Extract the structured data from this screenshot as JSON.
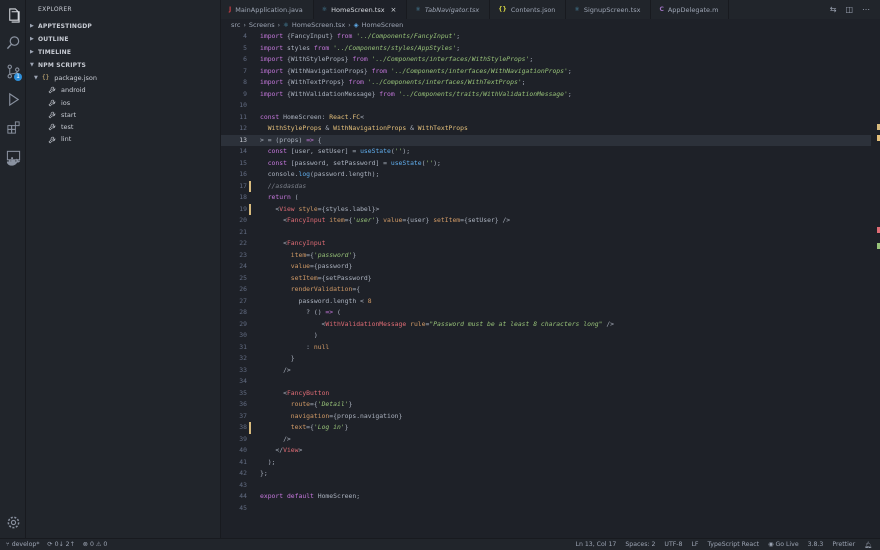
{
  "sidebar": {
    "title": "EXPLORER",
    "sections": [
      "APPTESTINGDP",
      "OUTLINE",
      "TIMELINE",
      "NPM SCRIPTS"
    ],
    "npm": {
      "package": "package.json",
      "scripts": [
        "android",
        "ios",
        "start",
        "test",
        "lint"
      ]
    }
  },
  "tabs": [
    {
      "label": "MainApplication.java",
      "icon": "J",
      "color": "#cc3e44",
      "active": false,
      "italic": false
    },
    {
      "label": "HomeScreen.tsx",
      "icon": "⚛",
      "color": "#519aba",
      "active": true,
      "italic": false
    },
    {
      "label": "TabNavigator.tsx",
      "icon": "⚛",
      "color": "#519aba",
      "active": false,
      "italic": true
    },
    {
      "label": "Contents.json",
      "icon": "{}",
      "color": "#cbcb41",
      "active": false,
      "italic": false
    },
    {
      "label": "SignupScreen.tsx",
      "icon": "⚛",
      "color": "#519aba",
      "active": false,
      "italic": false
    },
    {
      "label": "AppDelegate.m",
      "icon": "C",
      "color": "#a074c4",
      "active": false,
      "italic": false
    }
  ],
  "breadcrumb": [
    "src",
    "Screens",
    "HomeScreen.tsx",
    "HomeScreen"
  ],
  "status": {
    "branch": "develop*",
    "sync": "0↓ 2↑",
    "problems": "⊗ 0 ⚠ 0",
    "position": "Ln 13, Col 17",
    "spaces": "Spaces: 2",
    "encoding": "UTF-8",
    "eol": "LF",
    "language": "TypeScript React",
    "golive": "Go Live",
    "version": "3.8.3",
    "formatter": "Prettier"
  },
  "code_lines": [
    {
      "n": "4",
      "html": "<span class='k'>import</span> {FancyInput} <span class='k'>from</span> <span class='s'>'../Components/FancyInput'</span>;"
    },
    {
      "n": "5",
      "html": "<span class='k'>import</span> styles <span class='k'>from</span> <span class='s'>'../Components/styles/AppStyles'</span>;"
    },
    {
      "n": "6",
      "html": "<span class='k'>import</span> {WithStyleProps} <span class='k'>from</span> <span class='s'>'../Components/interfaces/WithStyleProps'</span>;"
    },
    {
      "n": "7",
      "html": "<span class='k'>import</span> {WithNavigationProps} <span class='k'>from</span> <span class='s'>'../Components/interfaces/WithNavigationProps'</span>;"
    },
    {
      "n": "8",
      "html": "<span class='k'>import</span> {WithTextProps} <span class='k'>from</span> <span class='s'>'../Components/interfaces/WithTextProps'</span>;"
    },
    {
      "n": "9",
      "html": "<span class='k'>import</span> {WithValidationMessage} <span class='k'>from</span> <span class='s'>'../Components/traits/WithValidationMessage'</span>;"
    },
    {
      "n": "10",
      "html": ""
    },
    {
      "n": "11",
      "html": "<span class='k'>const</span> <span class='p'>HomeScreen</span>: <span class='t'>React</span>.<span class='t'>FC</span>&lt;"
    },
    {
      "n": "12",
      "html": "  <span class='t'>WithStyleProps</span> &amp; <span class='t'>WithNavigationProps</span> &amp; <span class='t'>WithTextProps</span>"
    },
    {
      "n": "13",
      "html": "&gt; = (<span class='p'>props</span>) <span class='k'>=&gt;</span> {"
    },
    {
      "n": "14",
      "html": "  <span class='k'>const</span> [user, setUser] = <span class='f'>useState</span>(<span class='s'>''</span>);"
    },
    {
      "n": "15",
      "html": "  <span class='k'>const</span> [password, setPassword] = <span class='f'>useState</span>(<span class='s'>''</span>);"
    },
    {
      "n": "16",
      "html": "  console.<span class='f'>log</span>(password.length);"
    },
    {
      "n": "17",
      "html": "  <span class='g'>//asdasdas</span>"
    },
    {
      "n": "18",
      "html": "  <span class='k'>return</span> ("
    },
    {
      "n": "19",
      "html": "    &lt;<span class='tag'>View</span> <span class='attr'>style</span>={styles.label}&gt;"
    },
    {
      "n": "20",
      "html": "      &lt;<span class='tag'>FancyInput</span> <span class='attr'>item</span>={<span class='s'>'user'</span>} <span class='attr'>value</span>={user} <span class='attr'>setItem</span>={setUser} /&gt;"
    },
    {
      "n": "21",
      "html": ""
    },
    {
      "n": "22",
      "html": "      &lt;<span class='tag'>FancyInput</span>"
    },
    {
      "n": "23",
      "html": "        <span class='attr'>item</span>={<span class='s'>'password'</span>}"
    },
    {
      "n": "24",
      "html": "        <span class='attr'>value</span>={password}"
    },
    {
      "n": "25",
      "html": "        <span class='attr'>setItem</span>={setPassword}"
    },
    {
      "n": "26",
      "html": "        <span class='attr'>renderValidation</span>={"
    },
    {
      "n": "27",
      "html": "          password.length &lt; <span class='n'>8</span>"
    },
    {
      "n": "28",
      "html": "            ? () <span class='k'>=&gt;</span> ("
    },
    {
      "n": "29",
      "html": "                &lt;<span class='tag'>WithValidationMessage</span> <span class='attr'>rule</span>=<span class='s'>\"Password must be at least 8 characters long\"</span> /&gt;"
    },
    {
      "n": "30",
      "html": "              )"
    },
    {
      "n": "31",
      "html": "            : <span class='n'>null</span>"
    },
    {
      "n": "32",
      "html": "        }"
    },
    {
      "n": "33",
      "html": "      /&gt;"
    },
    {
      "n": "34",
      "html": ""
    },
    {
      "n": "35",
      "html": "      &lt;<span class='tag'>FancyButton</span>"
    },
    {
      "n": "36",
      "html": "        <span class='attr'>route</span>={<span class='s'>'Detail'</span>}"
    },
    {
      "n": "37",
      "html": "        <span class='attr'>navigation</span>={props.navigation}"
    },
    {
      "n": "38",
      "html": "        <span class='attr'>text</span>={<span class='s'>'Log in'</span>}"
    },
    {
      "n": "39",
      "html": "      /&gt;"
    },
    {
      "n": "40",
      "html": "    &lt;/<span class='tag'>View</span>&gt;"
    },
    {
      "n": "41",
      "html": "  );"
    },
    {
      "n": "42",
      "html": "};"
    },
    {
      "n": "43",
      "html": ""
    },
    {
      "n": "44",
      "html": "<span class='k'>export</span> <span class='k'>default</span> HomeScreen;"
    },
    {
      "n": "45",
      "html": ""
    }
  ],
  "current_line": "13",
  "modified_lines": [
    "17",
    "19",
    "38"
  ]
}
